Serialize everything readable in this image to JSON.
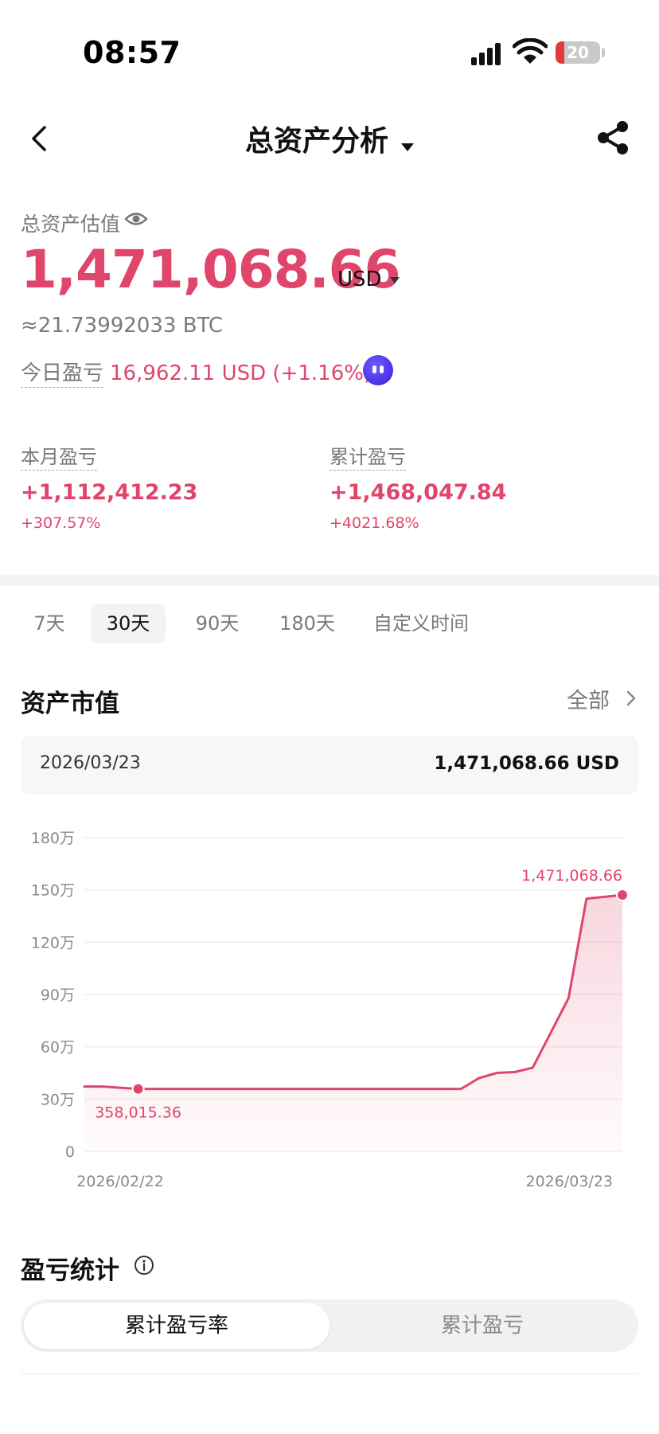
{
  "status_bar": {
    "time": "08:57",
    "battery": "20",
    "battery_level": 0.2
  },
  "nav": {
    "title": "总资产分析",
    "back_icon": "chevron-left-icon",
    "share_icon": "share-icon"
  },
  "overview": {
    "label": "总资产估值",
    "total_value": "1,471,068.66",
    "currency": "USD",
    "btc_equivalent": "≈21.73992033 BTC",
    "today_label": "今日盈亏",
    "today_value": "16,962.11 USD (+1.16%)"
  },
  "stats": {
    "month": {
      "label": "本月盈亏",
      "value": "+1,112,412.23",
      "percent": "+307.57%"
    },
    "total": {
      "label": "累计盈亏",
      "value": "+1,468,047.84",
      "percent": "+4021.68%"
    }
  },
  "period_tabs": [
    {
      "label": "7天",
      "active": false
    },
    {
      "label": "30天",
      "active": true
    },
    {
      "label": "90天",
      "active": false
    },
    {
      "label": "180天",
      "active": false
    },
    {
      "label": "自定义时间",
      "active": false
    }
  ],
  "asset_section": {
    "title": "资产市值",
    "all_link": "全部",
    "selected_date": "2026/03/23",
    "selected_value": "1,471,068.66 USD"
  },
  "chart_data": {
    "type": "area",
    "ylabel": "",
    "y_ticks": [
      "0",
      "30万",
      "60万",
      "90万",
      "120万",
      "150万",
      "180万"
    ],
    "ylim": [
      0,
      1800000
    ],
    "x_tick_labels": [
      "2026/02/22",
      "2026/03/23"
    ],
    "grid": true,
    "colors": {
      "line": "#e0456b"
    },
    "series": [
      {
        "values": [
          372000,
          372000,
          365000,
          358015.36,
          358015.36,
          358015.36,
          358015.36,
          358015.36,
          358015.36,
          358015.36,
          358015.36,
          358015.36,
          358015.36,
          358015.36,
          358015.36,
          358015.36,
          358015.36,
          358015.36,
          358015.36,
          358015.36,
          358015.36,
          358015.36,
          420000,
          450000,
          455000,
          480000,
          680000,
          880000,
          1450000,
          1460000,
          1471068.66
        ]
      }
    ],
    "annotations": [
      {
        "index": 3,
        "label": "358,015.36",
        "position": "below"
      },
      {
        "index": 30,
        "label": "1,471,068.66",
        "position": "above"
      }
    ]
  },
  "pnl_section": {
    "title": "盈亏统计",
    "segments": [
      {
        "label": "累计盈亏率",
        "active": true
      },
      {
        "label": "累计盈亏",
        "active": false
      }
    ]
  }
}
